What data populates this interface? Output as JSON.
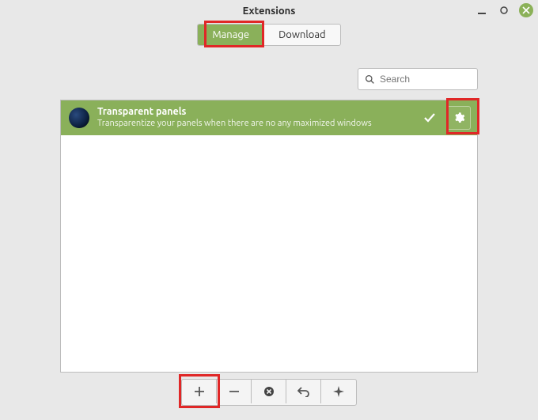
{
  "window": {
    "title": "Extensions"
  },
  "tabs": {
    "manage": "Manage",
    "download": "Download",
    "active": "manage"
  },
  "search": {
    "placeholder": "Search"
  },
  "extensions": [
    {
      "title": "Transparent panels",
      "description": "Transparentize your panels when there are no any maximized windows",
      "enabled": true
    }
  ],
  "toolbar": {
    "add": "+",
    "remove": "−",
    "disable": "✖",
    "undo": "↶",
    "more": "✦"
  },
  "colors": {
    "accent": "#8ab05a",
    "highlight": "#e02727"
  }
}
